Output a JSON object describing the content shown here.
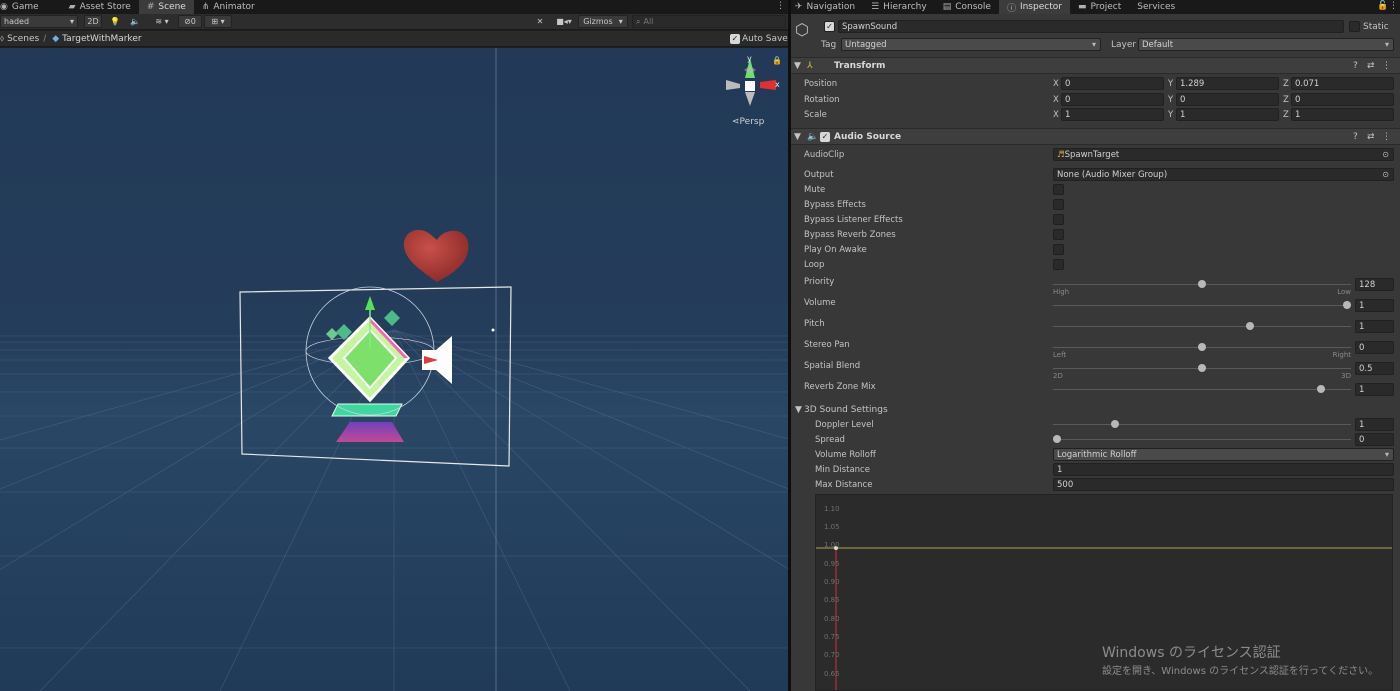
{
  "left_tabs": [
    {
      "label": "Game",
      "icon": "game-icon"
    },
    {
      "label": "Asset Store",
      "icon": "asset-store-icon"
    },
    {
      "label": "Scene",
      "icon": "scene-grid-icon"
    },
    {
      "label": "Animator",
      "icon": "animator-icon"
    }
  ],
  "scene_toolbar": {
    "shading": "haded",
    "mode_2d": "2D",
    "hidden_count": "0",
    "gizmos": "Gizmos",
    "search_placeholder": "All"
  },
  "breadcrumb": {
    "root": "Scenes",
    "separator": "/",
    "item": "TargetWithMarker",
    "auto_save": "Auto Save"
  },
  "gizmo": {
    "y": "y",
    "x": "x",
    "persp": "Persp"
  },
  "right_tabs": [
    {
      "label": "Navigation",
      "icon": "navigation-icon"
    },
    {
      "label": "Hierarchy",
      "icon": "hierarchy-icon"
    },
    {
      "label": "Console",
      "icon": "console-icon"
    },
    {
      "label": "Inspector",
      "icon": "info-icon"
    },
    {
      "label": "Project",
      "icon": "folder-icon"
    },
    {
      "label": "Services",
      "icon": ""
    }
  ],
  "object": {
    "name": "SpawnSound",
    "static_label": "Static",
    "tag_label": "Tag",
    "tag": "Untagged",
    "layer_label": "Layer",
    "layer": "Default"
  },
  "transform": {
    "title": "Transform",
    "rows": [
      {
        "label": "Position",
        "x": "0",
        "y": "1.289",
        "z": "0.071"
      },
      {
        "label": "Rotation",
        "x": "0",
        "y": "0",
        "z": "0"
      },
      {
        "label": "Scale",
        "x": "1",
        "y": "1",
        "z": "1"
      }
    ],
    "axis": {
      "x": "X",
      "y": "Y",
      "z": "Z"
    }
  },
  "audio_source": {
    "title": "Audio Source",
    "audioclip_label": "AudioClip",
    "audioclip": "SpawnTarget",
    "output_label": "Output",
    "output": "None (Audio Mixer Group)",
    "toggles": [
      "Mute",
      "Bypass Effects",
      "Bypass Listener Effects",
      "Bypass Reverb Zones",
      "Play On Awake",
      "Loop"
    ],
    "sliders": [
      {
        "label": "Priority",
        "value": "128",
        "fraction": 0.5,
        "left": "High",
        "right": "Low"
      },
      {
        "label": "Volume",
        "value": "1",
        "fraction": 1.0,
        "left": "",
        "right": ""
      },
      {
        "label": "Pitch",
        "value": "1",
        "fraction": 0.667,
        "left": "",
        "right": ""
      },
      {
        "label": "Stereo Pan",
        "value": "0",
        "fraction": 0.5,
        "left": "Left",
        "right": "Right"
      },
      {
        "label": "Spatial Blend",
        "value": "0.5",
        "fraction": 0.5,
        "left": "2D",
        "right": "3D"
      },
      {
        "label": "Reverb Zone Mix",
        "value": "1",
        "fraction": 0.909,
        "left": "",
        "right": ""
      }
    ]
  },
  "sound3d": {
    "title": "3D Sound Settings",
    "doppler_label": "Doppler Level",
    "doppler": "1",
    "doppler_fraction": 0.2,
    "spread_label": "Spread",
    "spread": "0",
    "spread_fraction": 0,
    "rolloff_label": "Volume Rolloff",
    "rolloff": "Logarithmic Rolloff",
    "min_label": "Min Distance",
    "min": "1",
    "max_label": "Max Distance",
    "max": "500",
    "graph_labels": [
      "1.10",
      "1.05",
      "1.00",
      "0.95",
      "0.90",
      "0.85",
      "0.80",
      "0.75",
      "0.70",
      "0.65"
    ]
  },
  "watermark": {
    "line1": "Windows のライセンス認証",
    "line2": "設定を開き、Windows のライセンス認証を行ってください。"
  },
  "colors": {
    "scene_bg": "#243b55",
    "accent_tab": "#3c3c3c",
    "heart": "#b03a35"
  }
}
